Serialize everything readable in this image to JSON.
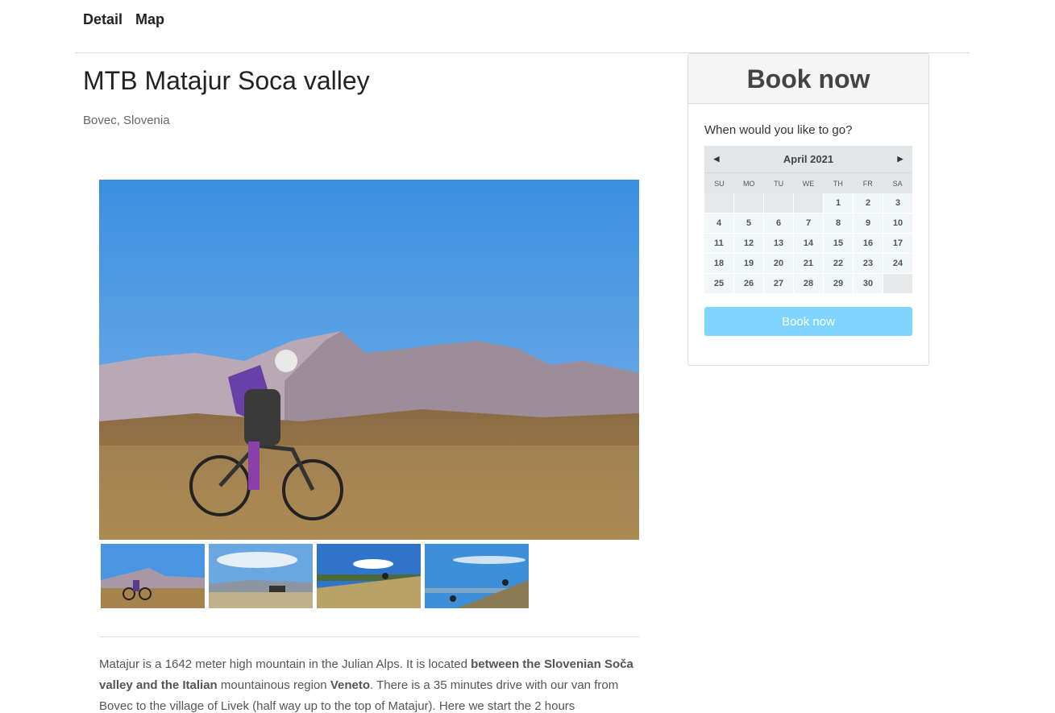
{
  "nav": {
    "detail": "Detail",
    "map": "Map"
  },
  "trip": {
    "title": "MTB Matajur Soca valley",
    "location": "Bovec, Slovenia"
  },
  "booking": {
    "header": "Book now",
    "question": "When would you like to go?",
    "button": "Book now",
    "button_color": "#7fd5ff"
  },
  "calendar": {
    "month": "April 2021",
    "prev_icon": "triangle-left-icon",
    "next_icon": "triangle-right-icon",
    "weekdays": [
      "SU",
      "MO",
      "TU",
      "WE",
      "TH",
      "FR",
      "SA"
    ],
    "days": [
      "1",
      "2",
      "3",
      "4",
      "5",
      "6",
      "7",
      "8",
      "9",
      "10",
      "11",
      "12",
      "13",
      "14",
      "15",
      "16",
      "17",
      "18",
      "19",
      "20",
      "21",
      "22",
      "23",
      "24",
      "25",
      "26",
      "27",
      "28",
      "29",
      "30"
    ]
  },
  "description": {
    "p1": "Matajur is a 1642 meter high mountain in the Julian Alps. It is located ",
    "b1": "between the Slovenian Soča valley and the Italian",
    "p2": " mountainous region ",
    "b2": "Veneto",
    "p3": ". There is a 35 minutes drive with our van from Bovec to the village of Livek (half way up to the top of Matajur). Here we start the 2 hours"
  }
}
